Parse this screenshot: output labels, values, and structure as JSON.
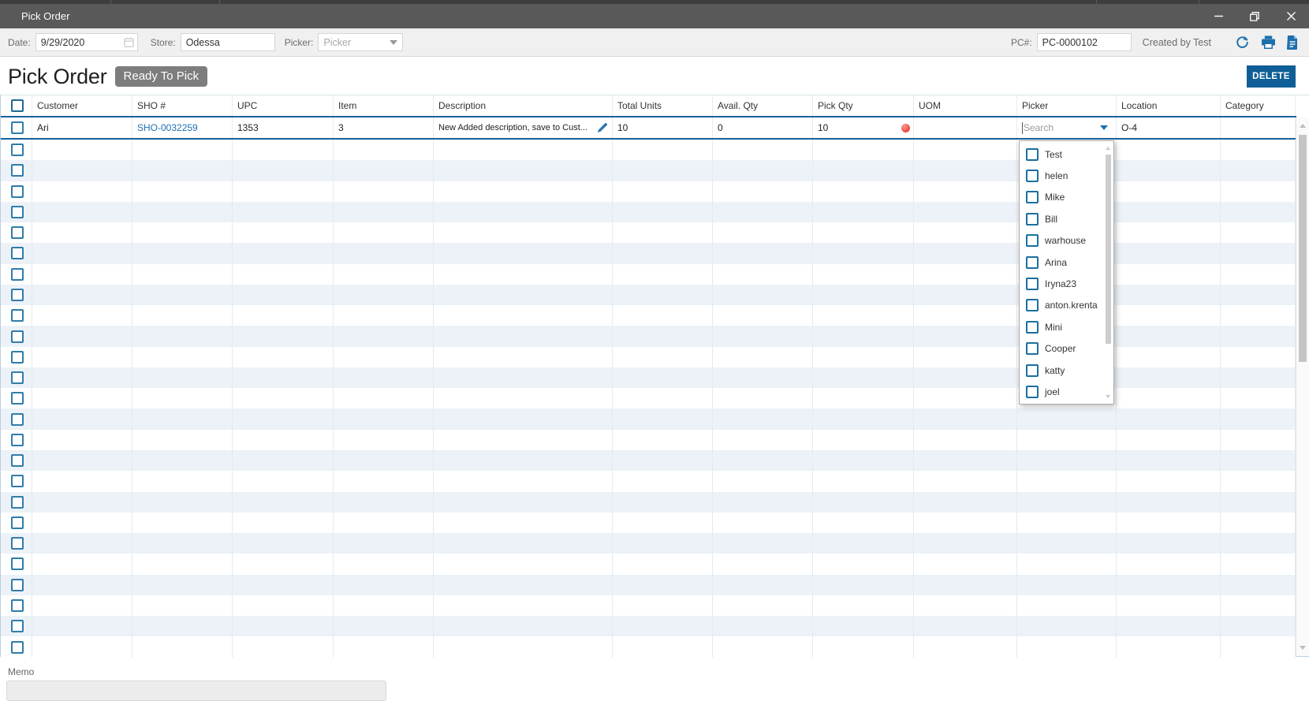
{
  "window": {
    "title": "Pick Order"
  },
  "toolbar": {
    "date_label": "Date:",
    "date_value": "9/29/2020",
    "store_label": "Store:",
    "store_value": "Odessa",
    "picker_label": "Picker:",
    "picker_placeholder": "Picker",
    "pc_label": "PC#:",
    "pc_value": "PC-0000102",
    "created_by": "Created by Test"
  },
  "icons": [
    "calendar-icon",
    "refresh-icon",
    "print-icon",
    "document-icon",
    "edit-pencil-icon",
    "dropdown-arrow-icon",
    "minimize-icon",
    "restore-icon",
    "close-icon"
  ],
  "page": {
    "title": "Pick Order",
    "status_badge": "Ready To Pick",
    "delete_label": "DELETE"
  },
  "table": {
    "columns": [
      "Customer",
      "SHO #",
      "UPC",
      "Item",
      "Description",
      "Total Units",
      "Avail. Qty",
      "Pick Qty",
      "UOM",
      "Picker",
      "Location",
      "Category"
    ],
    "row": {
      "customer": "Ari",
      "sho": "SHO-0032259",
      "upc": "1353",
      "item": "3",
      "description": "New Added description, save to Cust...",
      "total_units": "10",
      "avail_qty": "0",
      "pick_qty": "10",
      "uom_status_color": "#e8473c",
      "picker_search_placeholder": "Search",
      "location": "O-4",
      "category": ""
    },
    "empty_rows": 25
  },
  "picker_dropdown": {
    "options": [
      "Test",
      "helen",
      "Mike",
      "Bill",
      "warhouse",
      "Arina",
      "Iryna23",
      "anton.krenta",
      "Mini",
      "Cooper",
      "katty",
      "joel"
    ]
  },
  "memo": {
    "label": "Memo"
  },
  "colors": {
    "accent_blue": "#0f5e97",
    "header_border": "#19629c",
    "stripe": "#ecf2f7",
    "titlebar": "#595959",
    "badge": "#7d7d7d",
    "link": "#1f6fb2"
  }
}
